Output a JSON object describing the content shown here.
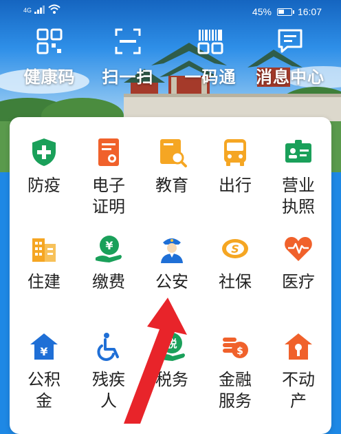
{
  "status_bar": {
    "signal_text": "4G",
    "battery": "45%",
    "battery_level": 0.45,
    "time": "16:07"
  },
  "quick_actions": [
    {
      "label": "健康码",
      "icon": "health-code-grid-icon"
    },
    {
      "label": "扫一扫",
      "icon": "scan-frame-icon"
    },
    {
      "label": "一码通",
      "icon": "barcode-icon"
    },
    {
      "label": "消息中心",
      "icon": "message-bubble-icon"
    }
  ],
  "services": [
    {
      "label": "防疫",
      "icon": "shield-plus-icon",
      "color": "#1aa05a"
    },
    {
      "label": "电子证明",
      "icon": "certificate-icon",
      "color": "#f0612b"
    },
    {
      "label": "教育",
      "icon": "education-search-icon",
      "color": "#f5a623"
    },
    {
      "label": "出行",
      "icon": "bus-icon",
      "color": "#f5a623"
    },
    {
      "label": "营业执照",
      "icon": "license-card-icon",
      "color": "#1aa05a"
    },
    {
      "label": "住建",
      "icon": "building-icon",
      "color": "#f5a623"
    },
    {
      "label": "缴费",
      "icon": "payment-hand-icon",
      "color": "#1aa05a"
    },
    {
      "label": "公安",
      "icon": "police-officer-icon",
      "color": "#1f6fd6"
    },
    {
      "label": "社保",
      "icon": "social-security-icon",
      "color": "#f5a623"
    },
    {
      "label": "医疗",
      "icon": "heart-pulse-icon",
      "color": "#f0612b"
    },
    {
      "label": "公积金",
      "icon": "housing-fund-icon",
      "color": "#1f6fd6"
    },
    {
      "label": "残疾人",
      "icon": "wheelchair-icon",
      "color": "#1f6fd6"
    },
    {
      "label": "税务",
      "icon": "tax-icon",
      "color": "#1aa05a"
    },
    {
      "label": "金融服务",
      "icon": "coins-icon",
      "color": "#f0612b"
    },
    {
      "label": "不动产",
      "icon": "property-key-icon",
      "color": "#f0612b"
    }
  ],
  "tax_icon_text": "税",
  "colors": {
    "annotation_arrow": "#e8242a",
    "header_blue": "#1e88e5",
    "panel_background": "#ffffff"
  }
}
